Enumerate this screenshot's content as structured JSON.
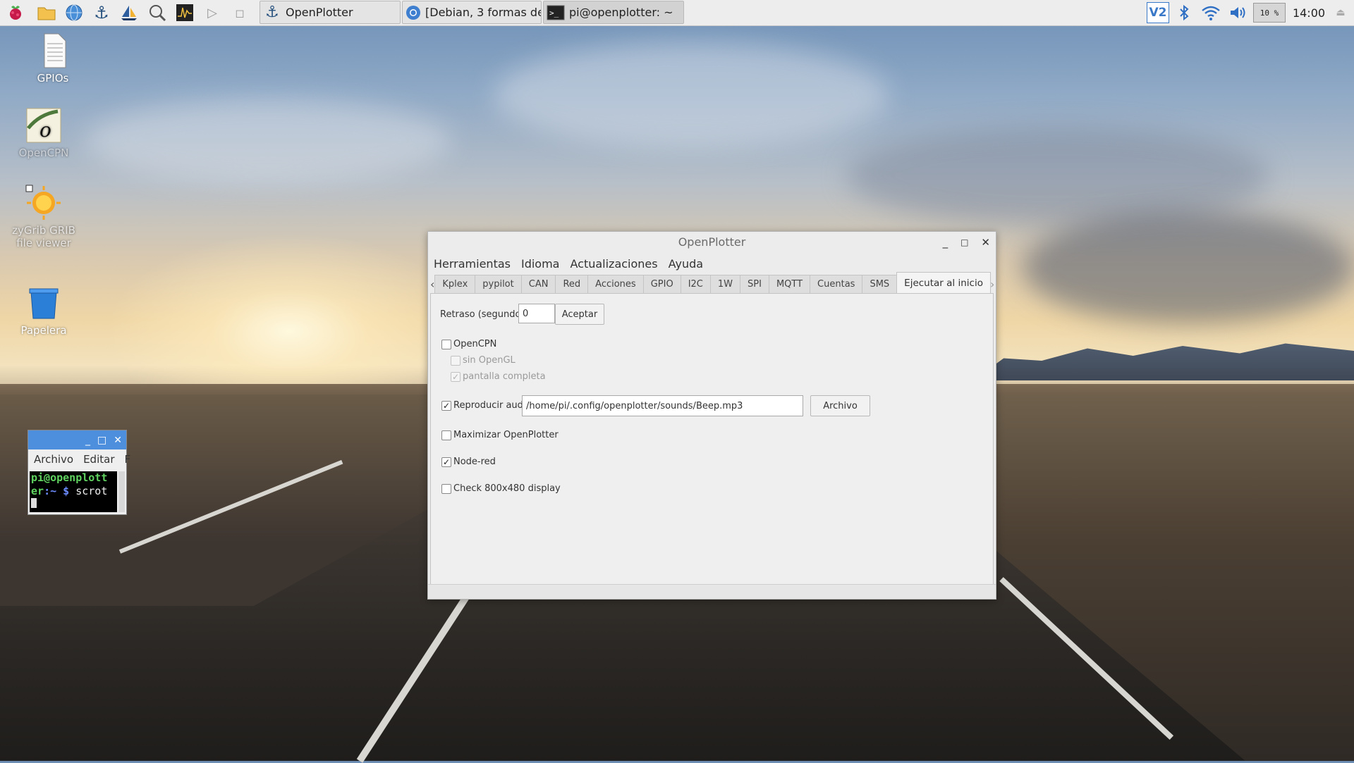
{
  "taskbar": {
    "tasks": [
      {
        "label": "OpenPlotter",
        "icon": "anchor-icon"
      },
      {
        "label": "[Debian, 3 formas de ...",
        "icon": "chromium-icon"
      },
      {
        "label": "pi@openplotter: ~",
        "icon": "terminal-icon"
      }
    ],
    "tray": {
      "vnc": "V2",
      "cpu": "10 %",
      "clock": "14:00"
    }
  },
  "desktop": {
    "icons": [
      {
        "label": "GPIOs"
      },
      {
        "label": "OpenCPN"
      },
      {
        "label": "zyGrib GRIB file viewer"
      },
      {
        "label": "Papelera"
      }
    ]
  },
  "terminal": {
    "menu": [
      "Archivo",
      "Editar",
      "F"
    ],
    "line1": "pi@openplott",
    "line2_host": "er",
    "line2_path": ":~ $",
    "line2_cmd": " scrot"
  },
  "window": {
    "title": "OpenPlotter",
    "menu": [
      "Herramientas",
      "Idioma",
      "Actualizaciones",
      "Ayuda"
    ],
    "tabs": [
      "Kplex",
      "pypilot",
      "CAN",
      "Red",
      "Acciones",
      "GPIO",
      "I2C",
      "1W",
      "SPI",
      "MQTT",
      "Cuentas",
      "SMS",
      "Ejecutar al inicio"
    ],
    "active_tab": "Ejecutar al inicio",
    "delay_label": "Retraso (segundos)",
    "delay_value": "0",
    "accept_button": "Aceptar",
    "opencpn": {
      "label": "OpenCPN",
      "checked": false
    },
    "no_opengl": {
      "label": "sin OpenGL",
      "checked": false,
      "enabled": false
    },
    "fullscreen": {
      "label": "pantalla completa",
      "checked": true,
      "enabled": false
    },
    "play_audio": {
      "label": "Reproducir audio",
      "checked": true
    },
    "audio_path": "/home/pi/.config/openplotter/sounds/Beep.mp3",
    "file_button": "Archivo",
    "maximize": {
      "label": "Maximizar OpenPlotter",
      "checked": false
    },
    "node_red": {
      "label": "Node-red",
      "checked": true
    },
    "display_check": {
      "label": "Check 800x480 display",
      "checked": false
    }
  }
}
